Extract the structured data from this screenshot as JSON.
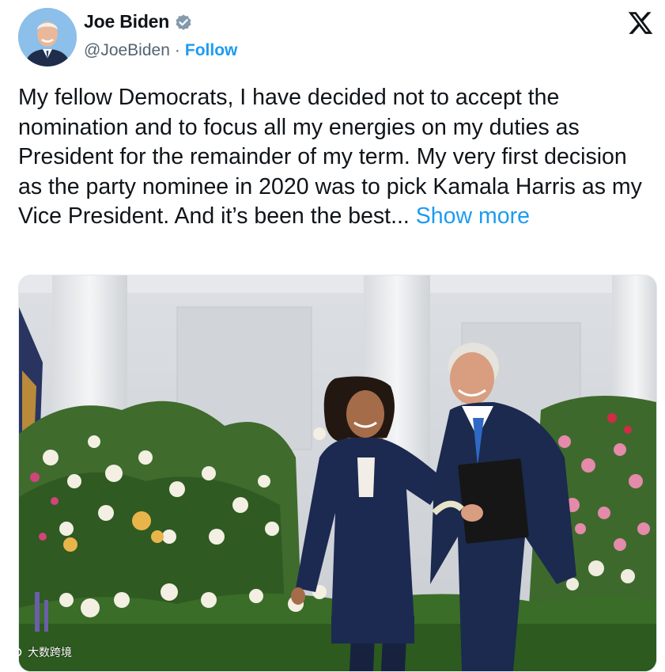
{
  "author": {
    "name": "Joe Biden",
    "handle": "@JoeBiden",
    "separator": "·",
    "follow_label": "Follow",
    "verified_icon": "verified-badge-icon",
    "avatar_icon": "avatar-portrait"
  },
  "platform": {
    "logo_icon": "x-logo-icon"
  },
  "tweet": {
    "text": "My fellow Democrats, I have decided not to accept the nomination and to focus all my energies on my duties as President for the remainder of my term. My very first decision as the party nominee in 2020 was to pick Kamala Harris as my Vice President. And it’s been the best... ",
    "show_more_label": "Show more"
  },
  "media": {
    "image_icon": "photo-garden-walk"
  },
  "watermark": {
    "text": "大数跨境"
  },
  "colors": {
    "accent": "#1d9bf0",
    "text": "#0f1419",
    "muted": "#536471"
  }
}
